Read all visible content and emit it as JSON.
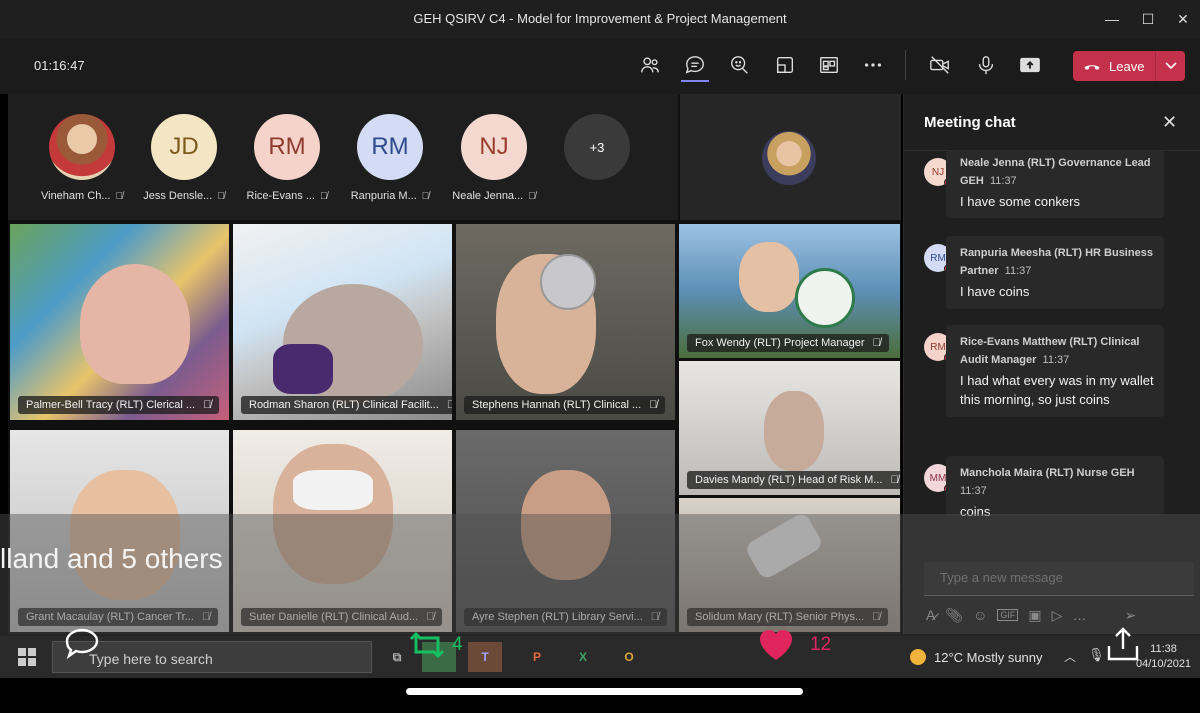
{
  "window": {
    "title": "GEH QSIRV C4 - Model for Improvement & Project Management",
    "minimize_glyph": "—",
    "maximize_glyph": "☐",
    "close_glyph": "✕"
  },
  "toolbar": {
    "timer": "01:16:47",
    "leave_label": "Leave",
    "icons": [
      "people-icon",
      "chat-icon",
      "reactions-icon",
      "rooms-icon",
      "apps-icon",
      "more-icon",
      "camera-off-icon",
      "mic-icon",
      "share-icon"
    ],
    "leave_color": "#c4314b"
  },
  "participants_row": [
    {
      "initials": "",
      "name": "Vineham Ch...",
      "bg": "#c9a37a"
    },
    {
      "initials": "JD",
      "name": "Jess Densle...",
      "bg": "#f4e6c4",
      "fg": "#7b5b1a"
    },
    {
      "initials": "RM",
      "name": "Rice-Evans ...",
      "bg": "#f5d3ca",
      "fg": "#8c3b2e"
    },
    {
      "initials": "RM",
      "name": "Ranpuria M...",
      "bg": "#d3dcf4",
      "fg": "#2f4a8c"
    },
    {
      "initials": "NJ",
      "name": "Neale Jenna...",
      "bg": "#f5d8d0",
      "fg": "#9a3f2e"
    },
    {
      "initials": "+3",
      "name": "",
      "bg": "#3a3a3a",
      "fg": "#ffffff"
    }
  ],
  "tiles": [
    {
      "label": "Palmer-Bell Tracy (RLT) Clerical ..."
    },
    {
      "label": "Rodman Sharon (RLT) Clinical Facilit..."
    },
    {
      "label": "Stephens Hannah (RLT) Clinical ..."
    },
    {
      "label": "Fox Wendy (RLT) Project Manager"
    },
    {
      "label": "Davies Mandy (RLT) Head of Risk M..."
    },
    {
      "label": "Grant Macaulay (RLT) Cancer Tr..."
    },
    {
      "label": "Suter Danielle (RLT) Clinical Aud..."
    },
    {
      "label": "Ayre Stephen (RLT) Library Servi..."
    },
    {
      "label": "Solidum Mary (RLT) Senior Phys..."
    }
  ],
  "overlay_text": "lland and 5 others",
  "chat": {
    "title": "Meeting chat",
    "messages": [
      {
        "initials": "NJ",
        "av_bg": "#f5d8d0",
        "av_fg": "#9a3f2e",
        "sender": "Neale Jenna (RLT) Governance Lead GEH",
        "time": "11:37",
        "text": "I have some conkers"
      },
      {
        "initials": "RM",
        "av_bg": "#d3dcf4",
        "av_fg": "#2f4a8c",
        "sender": "Ranpuria Meesha (RLT) HR Business Partner",
        "time": "11:37",
        "text": "I have coins"
      },
      {
        "initials": "RM",
        "av_bg": "#f5d3ca",
        "av_fg": "#8c3b2e",
        "sender": "Rice-Evans Matthew (RLT) Clinical Audit Manager",
        "time": "11:37",
        "text": "I had what every was in my wallet this morning, so just coins"
      },
      {
        "initials": "MM",
        "av_bg": "#f2d6da",
        "av_fg": "#8c3346",
        "sender": "Manchola Maira (RLT) Nurse GEH",
        "time": "11:37",
        "text": "coins"
      }
    ],
    "compose_placeholder": "Type a new message"
  },
  "taskbar": {
    "search_placeholder": "Type here to search",
    "weather": "12°C  Mostly sunny",
    "time": "11:38",
    "date": "04/10/2021"
  },
  "social": {
    "retweets": "4",
    "likes": "12",
    "retweet_color": "#17bf63",
    "like_color": "#e0245e"
  }
}
